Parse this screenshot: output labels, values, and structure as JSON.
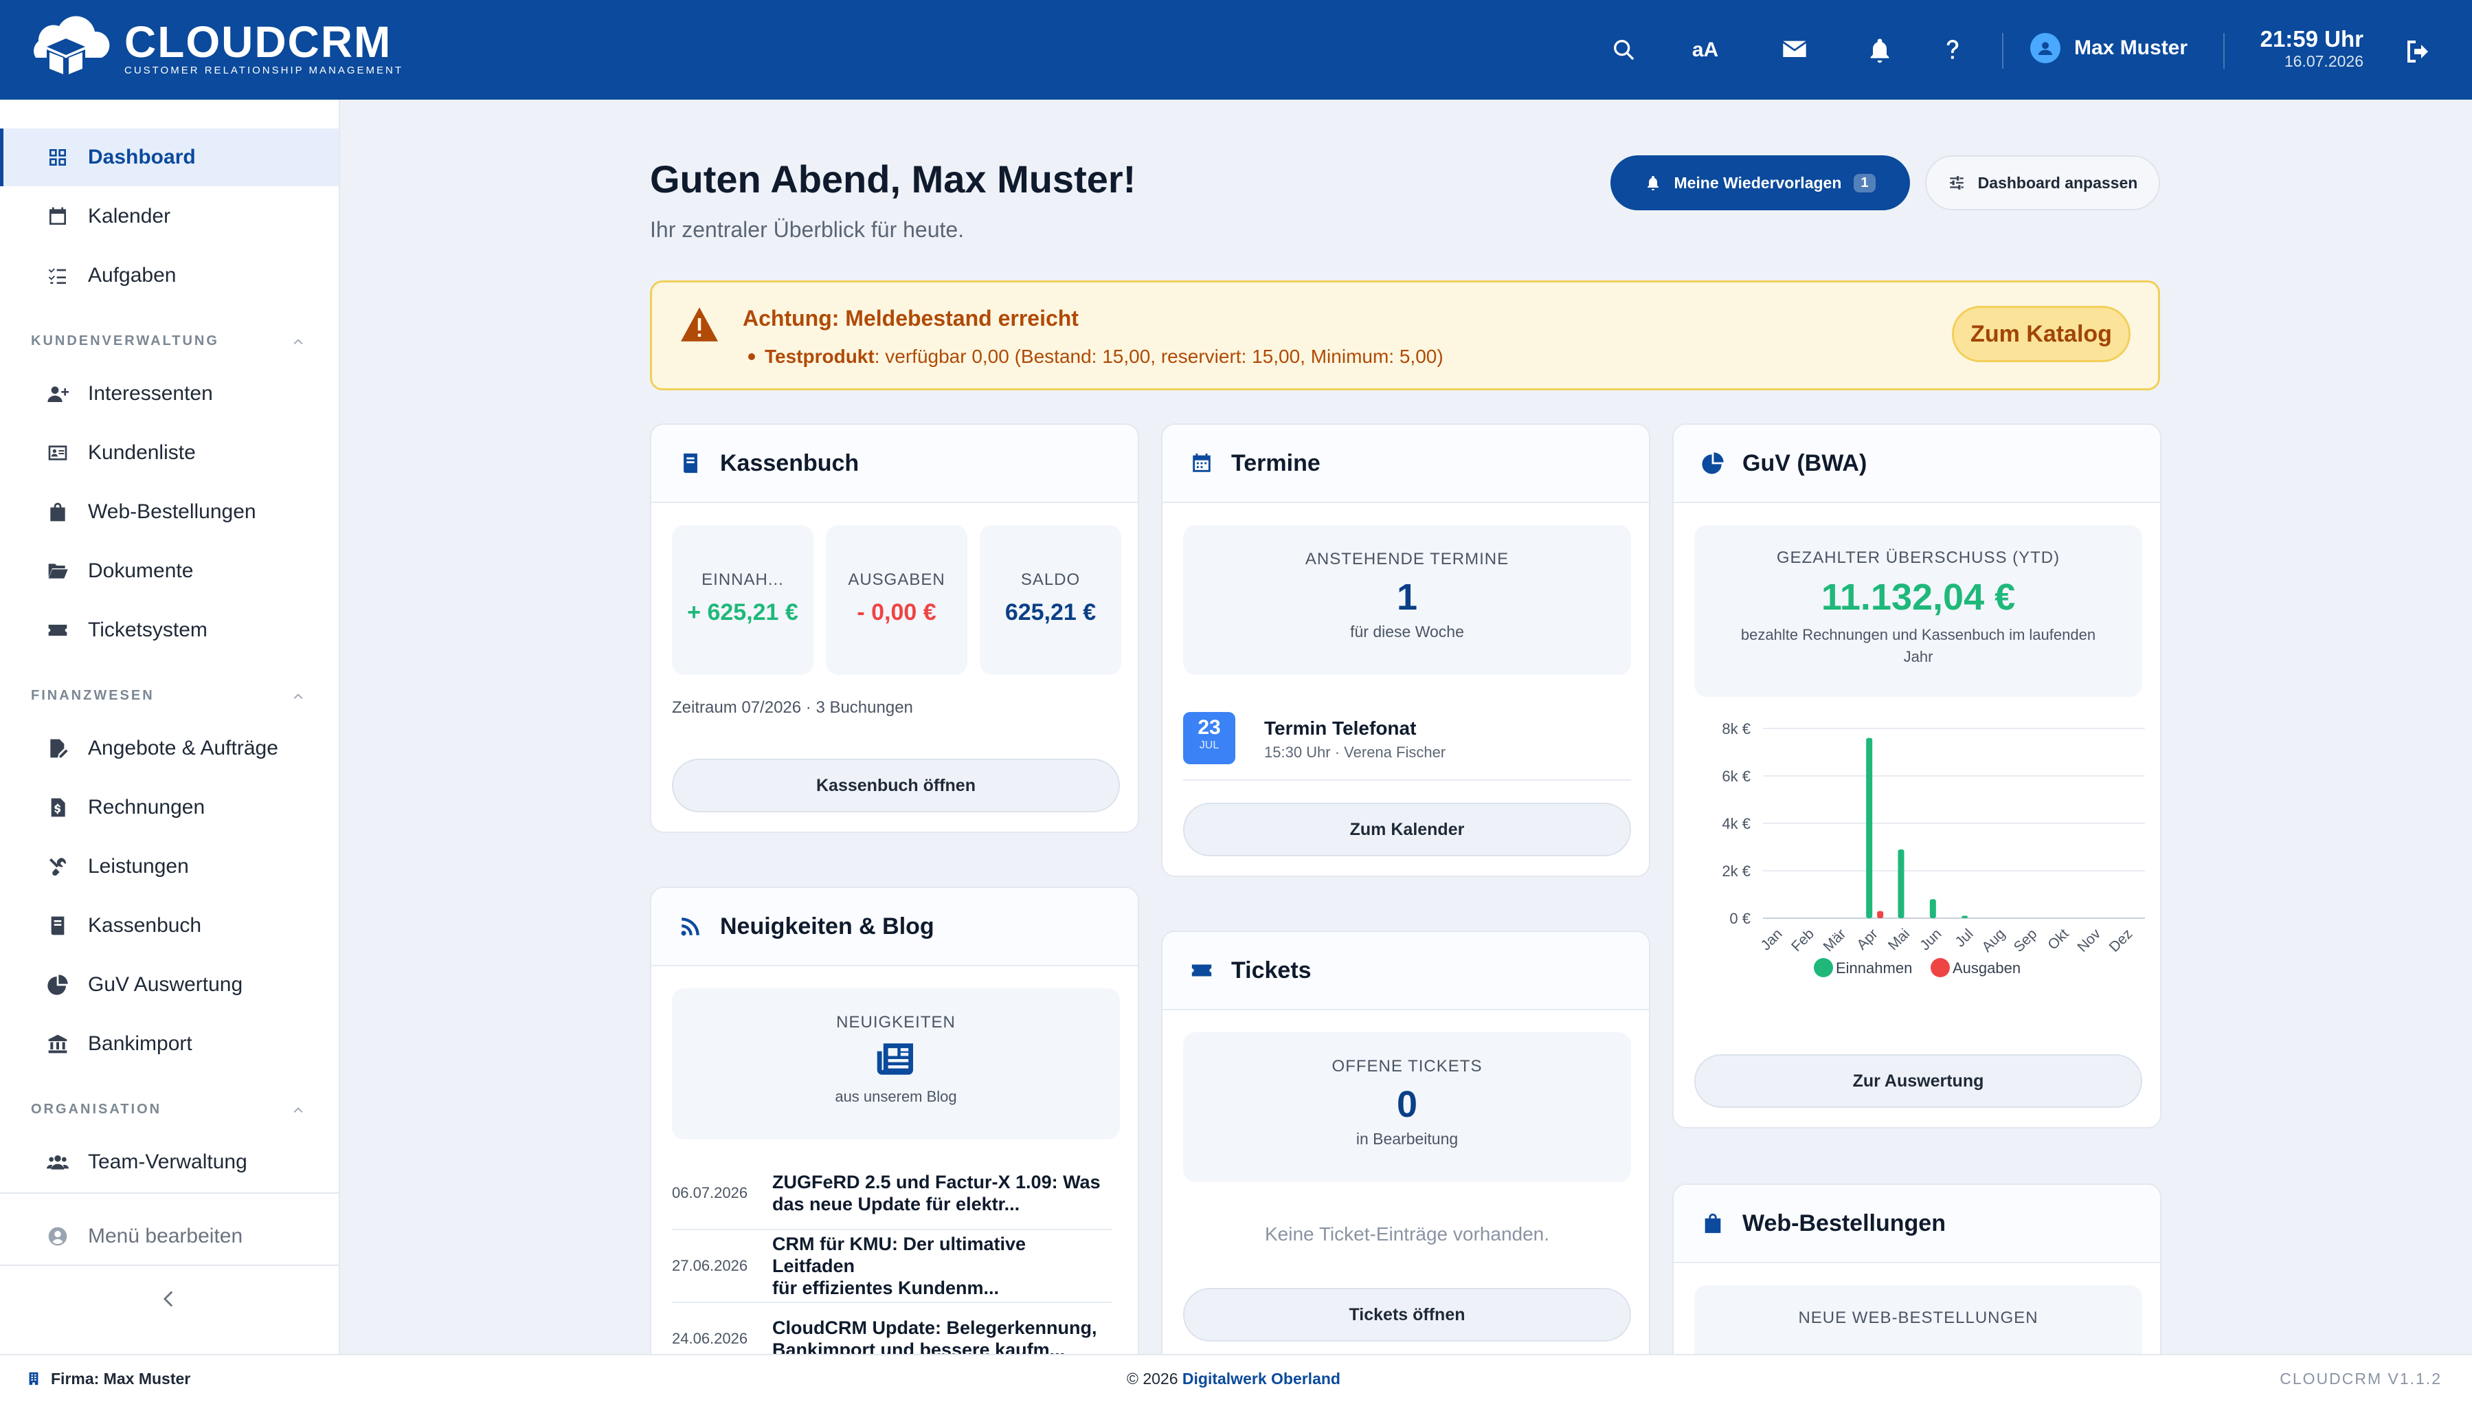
{
  "header": {
    "logo_title": "CLOUDCRM",
    "logo_subtitle": "CUSTOMER RELATIONSHIP MANAGEMENT",
    "font_size_label": "aA",
    "user_name": "Max Muster",
    "time": "21:59 Uhr",
    "date": "16.07.2026"
  },
  "sidebar": {
    "items_top": [
      {
        "label": "Dashboard",
        "icon": "dashboard-icon"
      },
      {
        "label": "Kalender",
        "icon": "calendar-icon"
      },
      {
        "label": "Aufgaben",
        "icon": "tasks-icon"
      }
    ],
    "section_kunden": "KUNDENVERWALTUNG",
    "items_kunden": [
      {
        "label": "Interessenten",
        "icon": "user-plus-icon"
      },
      {
        "label": "Kundenliste",
        "icon": "address-card-icon"
      },
      {
        "label": "Web-Bestellungen",
        "icon": "shopping-bag-icon"
      },
      {
        "label": "Dokumente",
        "icon": "folder-open-icon"
      },
      {
        "label": "Ticketsystem",
        "icon": "ticket-icon"
      }
    ],
    "section_finanz": "FINANZWESEN",
    "items_finanz": [
      {
        "label": "Angebote & Aufträge",
        "icon": "file-signature-icon"
      },
      {
        "label": "Rechnungen",
        "icon": "invoice-icon"
      },
      {
        "label": "Leistungen",
        "icon": "tools-icon"
      },
      {
        "label": "Kassenbuch",
        "icon": "book-icon"
      },
      {
        "label": "GuV Auswertung",
        "icon": "pie-chart-icon"
      },
      {
        "label": "Bankimport",
        "icon": "bank-icon"
      }
    ],
    "section_org": "ORGANISATION",
    "items_org": [
      {
        "label": "Team-Verwaltung",
        "icon": "users-icon"
      }
    ],
    "menu_edit": "Menü bearbeiten"
  },
  "main": {
    "greeting": "Guten Abend, Max Muster!",
    "subtitle": "Ihr zentraler Überblick für heute.",
    "btn_wiedervorlagen": "Meine Wiedervorlagen",
    "btn_wiedervorlagen_count": "1",
    "btn_dashboard": "Dashboard anpassen"
  },
  "alert": {
    "title": "Achtung: Meldebestand erreicht",
    "product": "Testprodukt",
    "detail": ": verfügbar 0,00 (Bestand: 15,00, reserviert: 15,00, Minimum: 5,00)",
    "button": "Zum Katalog",
    "color": "#b04a07"
  },
  "kassenbuch": {
    "title": "Kassenbuch",
    "einnahmen_label": "EINNAH...",
    "einnahmen_value": "+ 625,21 €",
    "ausgaben_label": "AUSGABEN",
    "ausgaben_value": "- 0,00 €",
    "saldo_label": "SALDO",
    "saldo_value": "625,21 €",
    "zeitraum": "Zeitraum 07/2026 · 3 Buchungen",
    "button": "Kassenbuch öffnen"
  },
  "termine": {
    "title": "Termine",
    "tile_label": "ANSTEHENDE TERMINE",
    "tile_value": "1",
    "tile_sub": "für diese Woche",
    "event_day": "23",
    "event_month": "JUL",
    "event_title": "Termin Telefonat",
    "event_sub": "15:30 Uhr · Verena Fischer",
    "button": "Zum Kalender"
  },
  "guv": {
    "title": "GuV (BWA)",
    "tile_label": "GEZAHLTER ÜBERSCHUSS (YTD)",
    "tile_value": "11.132,04 €",
    "tile_sub_1": "bezahlte Rechnungen und Kassenbuch im laufenden",
    "tile_sub_2": "Jahr",
    "button": "Zur Auswertung"
  },
  "news": {
    "title": "Neuigkeiten & Blog",
    "tile_label": "NEUIGKEITEN",
    "tile_sub": "aus unserem Blog",
    "items": [
      {
        "date": "06.07.2026",
        "title_1": "ZUGFeRD 2.5 und Factur-X 1.09: Was",
        "title_2": "das neue Update für elektr..."
      },
      {
        "date": "27.06.2026",
        "title_1": "CRM für KMU: Der ultimative Leitfaden",
        "title_2": "für effizientes Kundenm..."
      },
      {
        "date": "24.06.2026",
        "title_1": "CloudCRM Update: Belegerkennung,",
        "title_2": "Bankimport und bessere kaufm..."
      }
    ]
  },
  "tickets": {
    "title": "Tickets",
    "tile_label": "OFFENE TICKETS",
    "tile_value": "0",
    "tile_sub": "in Bearbeitung",
    "empty": "Keine Ticket-Einträge vorhanden.",
    "button": "Tickets öffnen"
  },
  "webshop": {
    "title": "Web-Bestellungen",
    "tile_label": "NEUE WEB-BESTELLUNGEN"
  },
  "footer": {
    "firma": "Firma: Max Muster",
    "copyright": "© 2026 ",
    "company_link": "Digitalwerk Oberland",
    "version": "CLOUDCRM V1.1.2"
  },
  "chart_data": {
    "type": "bar",
    "categories": [
      "Jan",
      "Feb",
      "Mär",
      "Apr",
      "Mai",
      "Jun",
      "Jul",
      "Aug",
      "Sep",
      "Okt",
      "Nov",
      "Dez"
    ],
    "series": [
      {
        "name": "Einnahmen",
        "color": "#1fb87a",
        "values": [
          0,
          0,
          0,
          7600,
          2900,
          800,
          100,
          0,
          0,
          0,
          0,
          0
        ]
      },
      {
        "name": "Ausgaben",
        "color": "#ef4444",
        "values": [
          0,
          0,
          0,
          300,
          0,
          0,
          0,
          0,
          0,
          0,
          0,
          0
        ]
      }
    ],
    "y_ticks": [
      "0 €",
      "2k €",
      "4k €",
      "6k €",
      "8k €"
    ],
    "ylim": [
      0,
      8000
    ],
    "grid": true,
    "legend": "bottom"
  }
}
